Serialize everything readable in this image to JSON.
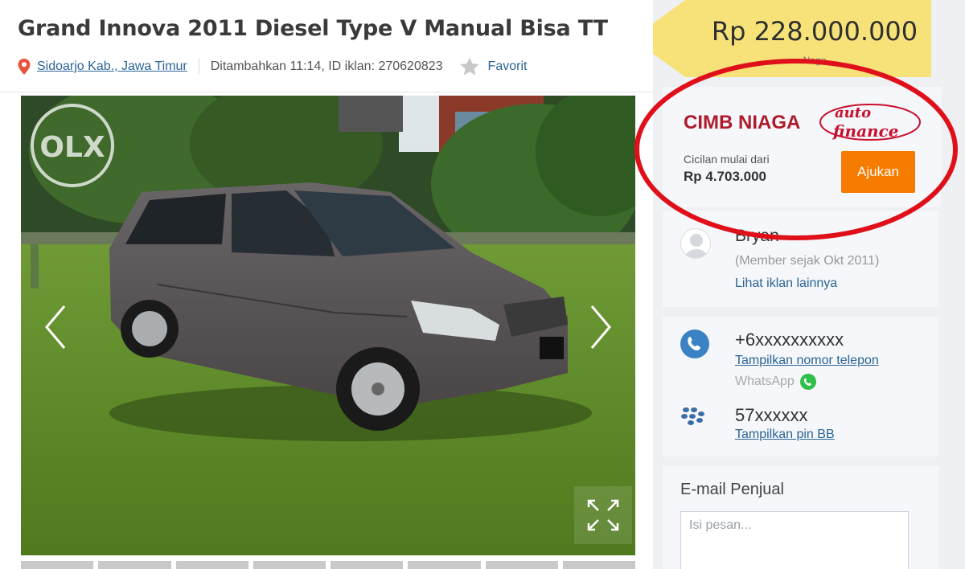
{
  "listing": {
    "title": "Grand Innova 2011 Diesel Type V Manual Bisa TT",
    "location": "Sidoarjo Kab., Jawa Timur",
    "added_info": "Ditambahkan 11:14, ID iklan: 270620823",
    "favorite_label": "Favorit"
  },
  "price": {
    "amount": "Rp 228.000.000",
    "tag": "Nego"
  },
  "finance": {
    "brand_main": "CIMB NIAGA",
    "brand_sub_1": "auto",
    "brand_sub_2": "finance",
    "installment_label": "Cicilan mulai dari",
    "installment_value": "Rp 4.703.000",
    "apply_label": "Ajukan"
  },
  "seller": {
    "name": "Bryan",
    "member_since": "(Member sejak Okt 2011)",
    "other_ads_link": "Lihat iklan lainnya"
  },
  "contact": {
    "phone": "+6xxxxxxxxxx",
    "show_phone": "Tampilkan nomor telepon",
    "whatsapp": "WhatsApp",
    "bb_pin": "57xxxxxx",
    "show_pin": "Tampilkan pin BB"
  },
  "email": {
    "title": "E-mail Penjual",
    "placeholder": "Isi pesan..."
  },
  "photo": {
    "watermark": "OLX"
  },
  "colors": {
    "price_bg": "#f7e27a",
    "apply_button": "#f57c00",
    "link": "#2a6496",
    "highlight_ring": "#e0101a",
    "cimb_red": "#b01a2a"
  }
}
